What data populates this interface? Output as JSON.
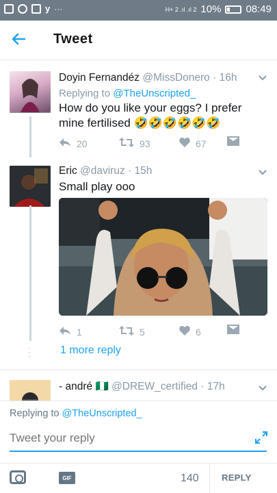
{
  "status_bar": {
    "signal": "H+ 2 .ıl .ıl 2",
    "battery": "10%",
    "time": "08:49",
    "dots": "···",
    "bird": "y"
  },
  "header": {
    "title": "Tweet"
  },
  "tweets": [
    {
      "name": "Doyin Fernandéz",
      "handle": "@MissDonero",
      "sep": "·",
      "time": "16h",
      "replying_label": "Replying to",
      "replying_handle": "@TheUnscripted_",
      "text": "How do you like your eggs? I prefer mine fertilised 🤣🤣🤣🤣🤣🤣",
      "replies": "20",
      "retweets": "93",
      "likes": "67"
    },
    {
      "name": "Eric",
      "handle": "@daviruz",
      "sep": "·",
      "time": "15h",
      "text": "Small play ooo",
      "replies": "1",
      "retweets": "5",
      "likes": "6"
    },
    {
      "name": "- andré",
      "flag": "🇳🇬",
      "handle": "@DREW_certified",
      "sep": "·",
      "time": "17h"
    }
  ],
  "more_replies": "1 more reply",
  "composer": {
    "replying_label": "Replying to",
    "replying_handle": "@TheUnscripted_",
    "placeholder": "Tweet your reply",
    "char_count": "140",
    "reply_button": "REPLY",
    "gif_label": "GIF"
  },
  "colors": {
    "accent": "#1da1f2",
    "status_bar": "#6f7b87",
    "muted": "#8899a6"
  },
  "icons": [
    "back-arrow-icon",
    "chevron-down-icon",
    "reply-icon",
    "retweet-icon",
    "heart-icon",
    "dm-icon",
    "expand-icon",
    "camera-icon",
    "gif-icon"
  ]
}
